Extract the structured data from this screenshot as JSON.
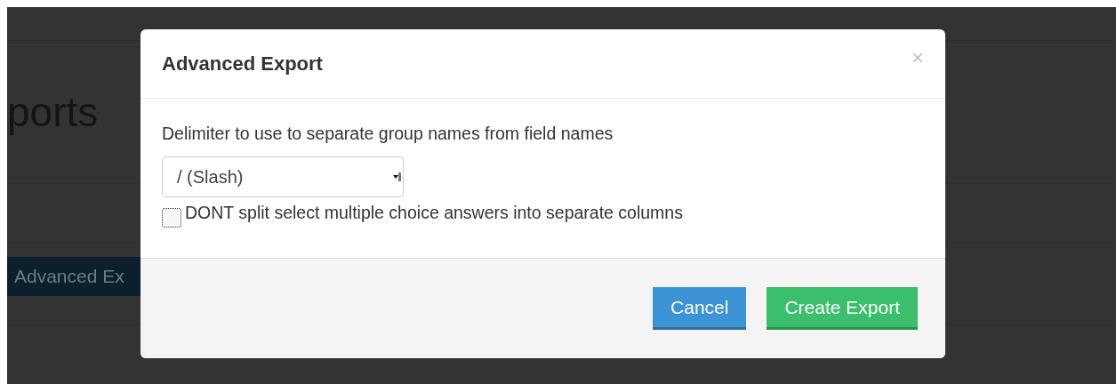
{
  "background": {
    "heading": "ports",
    "button": "Advanced Ex"
  },
  "dialog": {
    "title": "Advanced Export",
    "close": "×",
    "label": "Delimiter to use to separate group names from field names",
    "delimiter": {
      "value": "/ (Slash)"
    },
    "checkbox": {
      "label": "DONT split select multiple choice answers into separate columns",
      "checked": false
    },
    "buttons": [
      {
        "label": "Cancel",
        "kind": "secondary"
      },
      {
        "label": "Create Export",
        "kind": "primary"
      }
    ]
  }
}
